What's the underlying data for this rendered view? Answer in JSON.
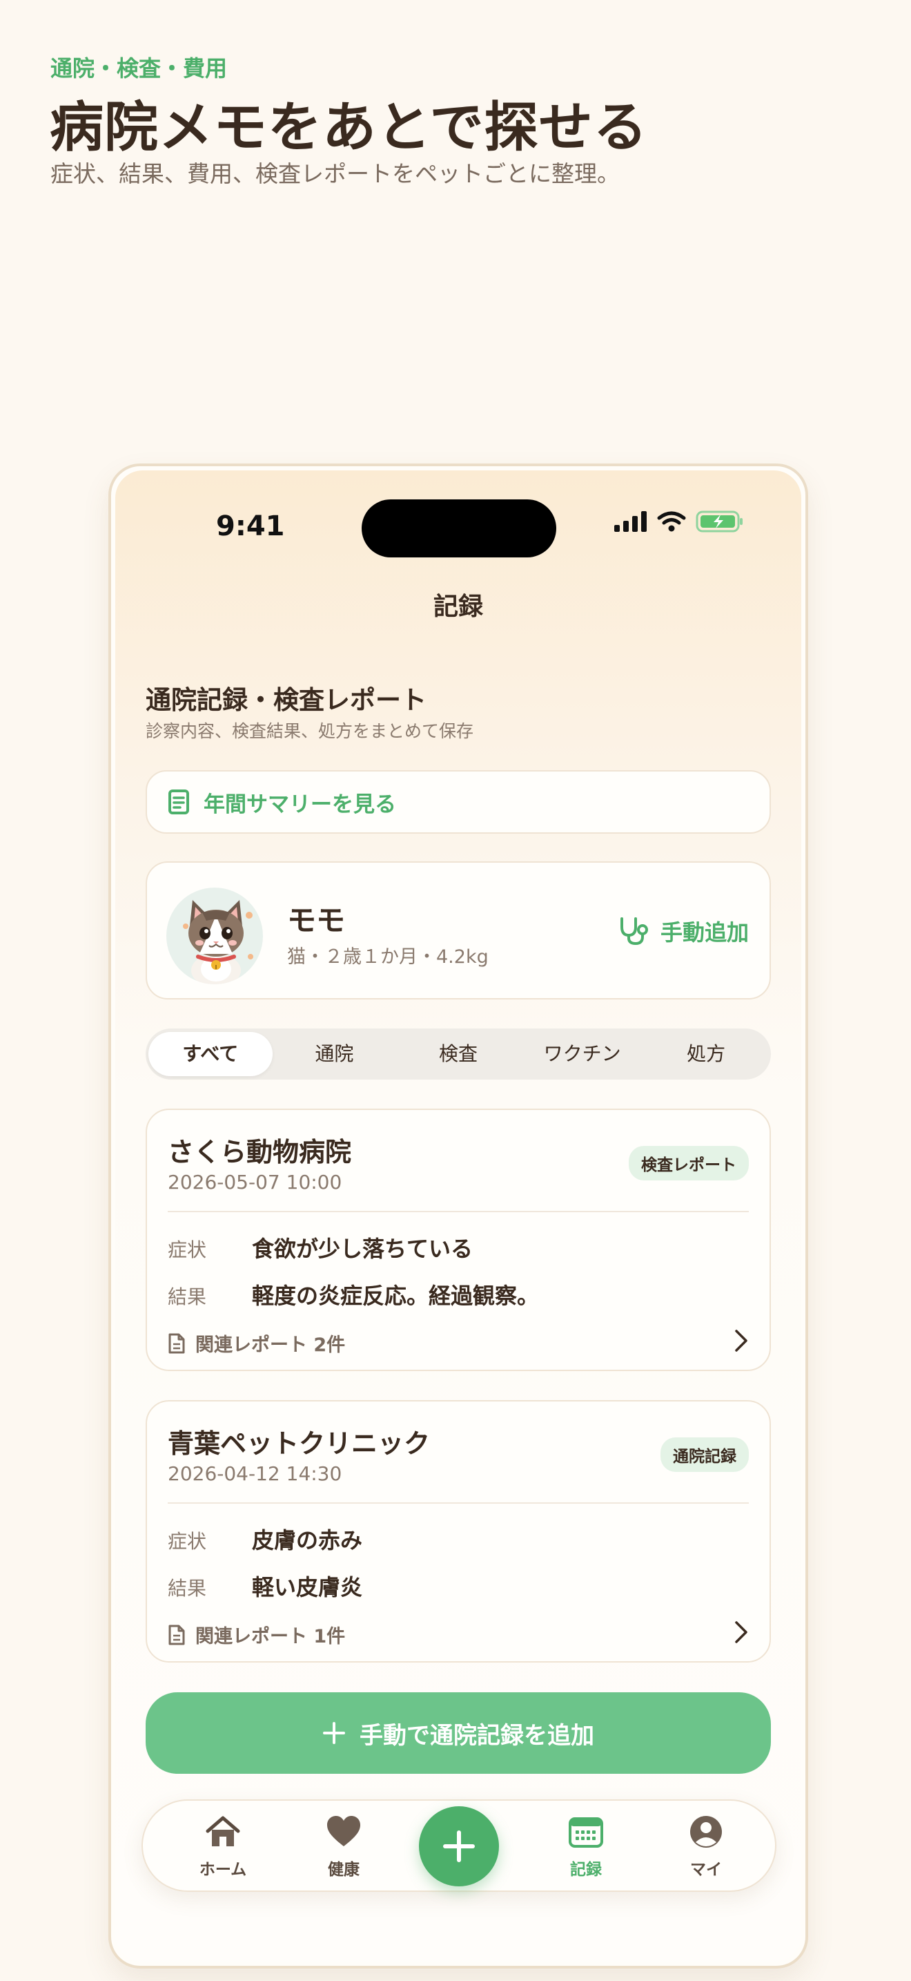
{
  "hero": {
    "eyebrow": "通院・検査・費用",
    "title": "病院メモをあとで探せる",
    "subtitle": "症状、結果、費用、検査レポートをペットごとに整理。"
  },
  "status_bar": {
    "time": "9:41"
  },
  "nav": {
    "title": "記録"
  },
  "section": {
    "title": "通院記録・検査レポート",
    "subtitle": "診察内容、検査結果、処方をまとめて保存"
  },
  "summary_button": {
    "label": "年間サマリーを見る",
    "icon": "document-icon"
  },
  "pet": {
    "name": "モモ",
    "meta": "猫・２歳１か月・4.2kg",
    "add_label": "手動追加",
    "add_icon": "stethoscope-icon"
  },
  "filter_tabs": [
    {
      "label": "すべて",
      "active": true
    },
    {
      "label": "通院",
      "active": false
    },
    {
      "label": "検査",
      "active": false
    },
    {
      "label": "ワクチン",
      "active": false
    },
    {
      "label": "処方",
      "active": false
    }
  ],
  "records": [
    {
      "clinic": "さくら動物病院",
      "date": "2026-05-07 10:00",
      "badge": "検査レポート",
      "symptom_label": "症状",
      "symptom": "食欲が少し落ちている",
      "result_label": "結果",
      "result": "軽度の炎症反応。経過観察。",
      "reports": "関連レポート 2件"
    },
    {
      "clinic": "青葉ペットクリニック",
      "date": "2026-04-12 14:30",
      "badge": "通院記録",
      "symptom_label": "症状",
      "symptom": "皮膚の赤み",
      "result_label": "結果",
      "result": "軽い皮膚炎",
      "reports": "関連レポート 1件"
    }
  ],
  "primary_button": {
    "label": "手動で通院記録を追加"
  },
  "tab_bar": [
    {
      "label": "ホーム",
      "icon": "home-icon",
      "active": false
    },
    {
      "label": "健康",
      "icon": "heart-icon",
      "active": false
    },
    {
      "label": "記録",
      "icon": "calendar-icon",
      "active": true
    },
    {
      "label": "マイ",
      "icon": "profile-icon",
      "active": false
    }
  ],
  "colors": {
    "accent": "#4CAF6A",
    "primary_button": "#6CC48A",
    "text": "#3A2A1F",
    "muted": "#8A7A6E",
    "background": "#FDF8F1"
  }
}
